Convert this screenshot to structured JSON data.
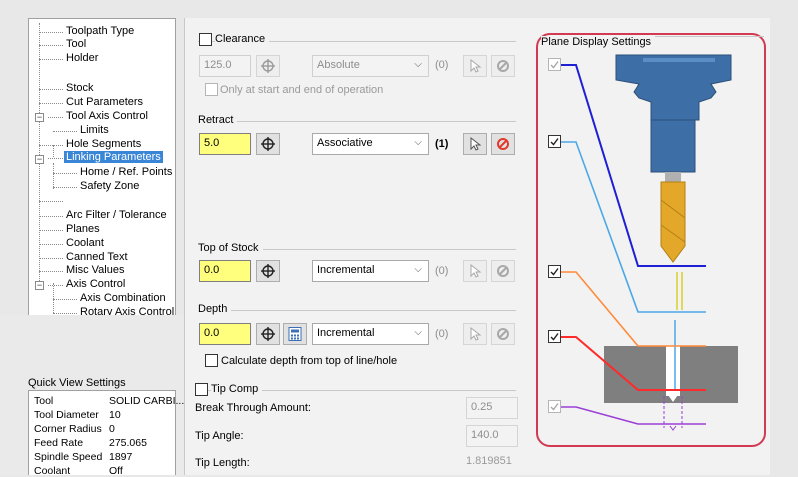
{
  "tree": {
    "items": [
      {
        "label": "Toolpath Type"
      },
      {
        "label": "Tool"
      },
      {
        "label": "Holder"
      },
      {
        "label": "Stock"
      },
      {
        "label": "Cut Parameters"
      },
      {
        "label": "Tool Axis Control"
      },
      {
        "label": "Limits"
      },
      {
        "label": "Hole Segments"
      },
      {
        "label": "Linking Parameters"
      },
      {
        "label": "Home / Ref. Points"
      },
      {
        "label": "Safety Zone"
      },
      {
        "label": "Arc Filter / Tolerance"
      },
      {
        "label": "Planes"
      },
      {
        "label": "Coolant"
      },
      {
        "label": "Canned Text"
      },
      {
        "label": "Misc Values"
      },
      {
        "label": "Axis Control"
      },
      {
        "label": "Axis Combination"
      },
      {
        "label": "Rotary Axis Control"
      }
    ]
  },
  "quick_view": {
    "title": "Quick View Settings",
    "rows": [
      {
        "label": "Tool",
        "value": "SOLID CARBI..."
      },
      {
        "label": "Tool Diameter",
        "value": "10"
      },
      {
        "label": "Corner Radius",
        "value": "0"
      },
      {
        "label": "Feed Rate",
        "value": "275.065"
      },
      {
        "label": "Spindle Speed",
        "value": "1897"
      },
      {
        "label": "Coolant",
        "value": "Off"
      }
    ]
  },
  "clearance": {
    "label": "Clearance",
    "value": "125.0",
    "mode": "Absolute",
    "count": "(0)",
    "start_end_label": "Only at start and end of operation"
  },
  "retract": {
    "label": "Retract",
    "value": "5.0",
    "mode": "Associative",
    "count": "(1)"
  },
  "top_of_stock": {
    "label": "Top of Stock",
    "value": "0.0",
    "mode": "Incremental",
    "count": "(0)"
  },
  "depth": {
    "label": "Depth",
    "value": "0.0",
    "mode": "Incremental",
    "count": "(0)",
    "calc_label": "Calculate depth from top of line/hole"
  },
  "tip_comp": {
    "label": "Tip Comp",
    "break_through_label": "Break Through Amount:",
    "break_through_value": "0.25",
    "tip_angle_label": "Tip Angle:",
    "tip_angle_value": "140.0",
    "tip_length_label": "Tip Length:",
    "tip_length_value": "1.819851"
  },
  "plane_display": {
    "title": "Plane Display Settings",
    "plane_colors": {
      "clearance": "#1f1fd6",
      "retract": "#4aa8e8",
      "top_of_stock": "#ff8a3a",
      "depth": "#ff2a2a",
      "tip": "#9b3fd6"
    },
    "highlight_color": "#d13a52",
    "checks": [
      {
        "checked": true,
        "disabled": true
      },
      {
        "checked": true,
        "disabled": false
      },
      {
        "checked": true,
        "disabled": false
      },
      {
        "checked": true,
        "disabled": false
      },
      {
        "checked": true,
        "disabled": true
      }
    ]
  }
}
